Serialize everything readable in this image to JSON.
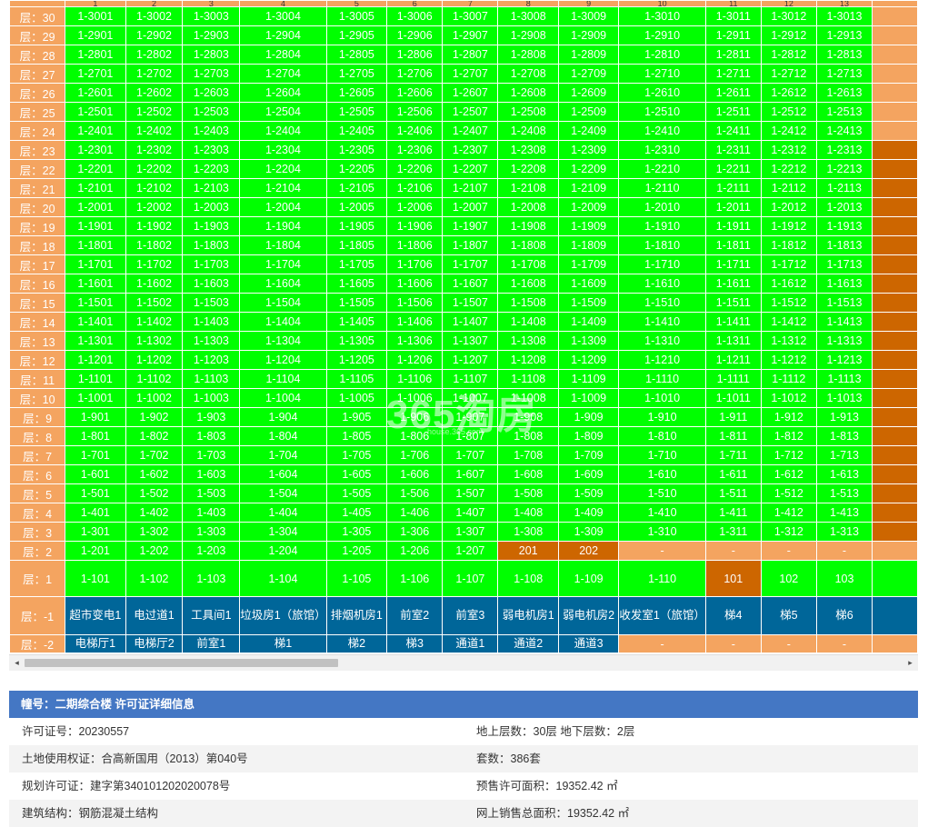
{
  "units": [
    "1",
    "2",
    "3",
    "4",
    "5",
    "6",
    "7",
    "8",
    "9",
    "10",
    "11",
    "12",
    "13"
  ],
  "floors": [
    {
      "label": "层：30",
      "cells": [
        "1-3001",
        "1-3002",
        "1-3003",
        "1-3004",
        "1-3005",
        "1-3006",
        "1-3007",
        "1-3008",
        "1-3009",
        "1-3010",
        "1-3011",
        "1-3012",
        "1-3013"
      ],
      "edge": "sale"
    },
    {
      "label": "层：29",
      "cells": [
        "1-2901",
        "1-2902",
        "1-2903",
        "1-2904",
        "1-2905",
        "1-2906",
        "1-2907",
        "1-2908",
        "1-2909",
        "1-2910",
        "1-2911",
        "1-2912",
        "1-2913"
      ],
      "edge": "sale"
    },
    {
      "label": "层：28",
      "cells": [
        "1-2801",
        "1-2802",
        "1-2803",
        "1-2804",
        "1-2805",
        "1-2806",
        "1-2807",
        "1-2808",
        "1-2809",
        "1-2810",
        "1-2811",
        "1-2812",
        "1-2813"
      ],
      "edge": "sale"
    },
    {
      "label": "层：27",
      "cells": [
        "1-2701",
        "1-2702",
        "1-2703",
        "1-2704",
        "1-2705",
        "1-2706",
        "1-2707",
        "1-2708",
        "1-2709",
        "1-2710",
        "1-2711",
        "1-2712",
        "1-2713"
      ],
      "edge": "sale"
    },
    {
      "label": "层：26",
      "cells": [
        "1-2601",
        "1-2602",
        "1-2603",
        "1-2604",
        "1-2605",
        "1-2606",
        "1-2607",
        "1-2608",
        "1-2609",
        "1-2610",
        "1-2611",
        "1-2612",
        "1-2613"
      ],
      "edge": "sale"
    },
    {
      "label": "层：25",
      "cells": [
        "1-2501",
        "1-2502",
        "1-2503",
        "1-2504",
        "1-2505",
        "1-2506",
        "1-2507",
        "1-2508",
        "1-2509",
        "1-2510",
        "1-2511",
        "1-2512",
        "1-2513"
      ],
      "edge": "sale"
    },
    {
      "label": "层：24",
      "cells": [
        "1-2401",
        "1-2402",
        "1-2403",
        "1-2404",
        "1-2405",
        "1-2406",
        "1-2407",
        "1-2408",
        "1-2409",
        "1-2410",
        "1-2411",
        "1-2412",
        "1-2413"
      ],
      "edge": "sale"
    },
    {
      "label": "层：23",
      "cells": [
        "1-2301",
        "1-2302",
        "1-2303",
        "1-2304",
        "1-2305",
        "1-2306",
        "1-2307",
        "1-2308",
        "1-2309",
        "1-2310",
        "1-2311",
        "1-2312",
        "1-2313"
      ],
      "edge": "sold"
    },
    {
      "label": "层：22",
      "cells": [
        "1-2201",
        "1-2202",
        "1-2203",
        "1-2204",
        "1-2205",
        "1-2206",
        "1-2207",
        "1-2208",
        "1-2209",
        "1-2210",
        "1-2211",
        "1-2212",
        "1-2213"
      ],
      "edge": "sold"
    },
    {
      "label": "层：21",
      "cells": [
        "1-2101",
        "1-2102",
        "1-2103",
        "1-2104",
        "1-2105",
        "1-2106",
        "1-2107",
        "1-2108",
        "1-2109",
        "1-2110",
        "1-2111",
        "1-2112",
        "1-2113"
      ],
      "edge": "sold"
    },
    {
      "label": "层：20",
      "cells": [
        "1-2001",
        "1-2002",
        "1-2003",
        "1-2004",
        "1-2005",
        "1-2006",
        "1-2007",
        "1-2008",
        "1-2009",
        "1-2010",
        "1-2011",
        "1-2012",
        "1-2013"
      ],
      "edge": "sold"
    },
    {
      "label": "层：19",
      "cells": [
        "1-1901",
        "1-1902",
        "1-1903",
        "1-1904",
        "1-1905",
        "1-1906",
        "1-1907",
        "1-1908",
        "1-1909",
        "1-1910",
        "1-1911",
        "1-1912",
        "1-1913"
      ],
      "edge": "sold"
    },
    {
      "label": "层：18",
      "cells": [
        "1-1801",
        "1-1802",
        "1-1803",
        "1-1804",
        "1-1805",
        "1-1806",
        "1-1807",
        "1-1808",
        "1-1809",
        "1-1810",
        "1-1811",
        "1-1812",
        "1-1813"
      ],
      "edge": "sold"
    },
    {
      "label": "层：17",
      "cells": [
        "1-1701",
        "1-1702",
        "1-1703",
        "1-1704",
        "1-1705",
        "1-1706",
        "1-1707",
        "1-1708",
        "1-1709",
        "1-1710",
        "1-1711",
        "1-1712",
        "1-1713"
      ],
      "edge": "sold"
    },
    {
      "label": "层：16",
      "cells": [
        "1-1601",
        "1-1602",
        "1-1603",
        "1-1604",
        "1-1605",
        "1-1606",
        "1-1607",
        "1-1608",
        "1-1609",
        "1-1610",
        "1-1611",
        "1-1612",
        "1-1613"
      ],
      "edge": "sold"
    },
    {
      "label": "层：15",
      "cells": [
        "1-1501",
        "1-1502",
        "1-1503",
        "1-1504",
        "1-1505",
        "1-1506",
        "1-1507",
        "1-1508",
        "1-1509",
        "1-1510",
        "1-1511",
        "1-1512",
        "1-1513"
      ],
      "edge": "sold"
    },
    {
      "label": "层：14",
      "cells": [
        "1-1401",
        "1-1402",
        "1-1403",
        "1-1404",
        "1-1405",
        "1-1406",
        "1-1407",
        "1-1408",
        "1-1409",
        "1-1410",
        "1-1411",
        "1-1412",
        "1-1413"
      ],
      "edge": "sold"
    },
    {
      "label": "层：13",
      "cells": [
        "1-1301",
        "1-1302",
        "1-1303",
        "1-1304",
        "1-1305",
        "1-1306",
        "1-1307",
        "1-1308",
        "1-1309",
        "1-1310",
        "1-1311",
        "1-1312",
        "1-1313"
      ],
      "edge": "sold"
    },
    {
      "label": "层：12",
      "cells": [
        "1-1201",
        "1-1202",
        "1-1203",
        "1-1204",
        "1-1205",
        "1-1206",
        "1-1207",
        "1-1208",
        "1-1209",
        "1-1210",
        "1-1211",
        "1-1212",
        "1-1213"
      ],
      "edge": "sold"
    },
    {
      "label": "层：11",
      "cells": [
        "1-1101",
        "1-1102",
        "1-1103",
        "1-1104",
        "1-1105",
        "1-1106",
        "1-1107",
        "1-1108",
        "1-1109",
        "1-1110",
        "1-1111",
        "1-1112",
        "1-1113"
      ],
      "edge": "sold"
    },
    {
      "label": "层：10",
      "cells": [
        "1-1001",
        "1-1002",
        "1-1003",
        "1-1004",
        "1-1005",
        "1-1006",
        "1-1007",
        "1-1008",
        "1-1009",
        "1-1010",
        "1-1011",
        "1-1012",
        "1-1013"
      ],
      "edge": "sold"
    },
    {
      "label": "层：9",
      "cells": [
        "1-901",
        "1-902",
        "1-903",
        "1-904",
        "1-905",
        "1-906",
        "1-907",
        "1-908",
        "1-909",
        "1-910",
        "1-911",
        "1-912",
        "1-913"
      ],
      "edge": "sold"
    },
    {
      "label": "层：8",
      "cells": [
        "1-801",
        "1-802",
        "1-803",
        "1-804",
        "1-805",
        "1-806",
        "1-807",
        "1-808",
        "1-809",
        "1-810",
        "1-811",
        "1-812",
        "1-813"
      ],
      "edge": "sold"
    },
    {
      "label": "层：7",
      "cells": [
        "1-701",
        "1-702",
        "1-703",
        "1-704",
        "1-705",
        "1-706",
        "1-707",
        "1-708",
        "1-709",
        "1-710",
        "1-711",
        "1-712",
        "1-713"
      ],
      "edge": "sold"
    },
    {
      "label": "层：6",
      "cells": [
        "1-601",
        "1-602",
        "1-603",
        "1-604",
        "1-605",
        "1-606",
        "1-607",
        "1-608",
        "1-609",
        "1-610",
        "1-611",
        "1-612",
        "1-613"
      ],
      "edge": "sold"
    },
    {
      "label": "层：5",
      "cells": [
        "1-501",
        "1-502",
        "1-503",
        "1-504",
        "1-505",
        "1-506",
        "1-507",
        "1-508",
        "1-509",
        "1-510",
        "1-511",
        "1-512",
        "1-513"
      ],
      "edge": "sold"
    },
    {
      "label": "层：4",
      "cells": [
        "1-401",
        "1-402",
        "1-403",
        "1-404",
        "1-405",
        "1-406",
        "1-407",
        "1-408",
        "1-409",
        "1-410",
        "1-411",
        "1-412",
        "1-413"
      ],
      "edge": "sold"
    },
    {
      "label": "层：3",
      "cells": [
        "1-301",
        "1-302",
        "1-303",
        "1-304",
        "1-305",
        "1-306",
        "1-307",
        "1-308",
        "1-309",
        "1-310",
        "1-311",
        "1-312",
        "1-313"
      ],
      "edge": "sold"
    }
  ],
  "floor2": {
    "label": "层：2",
    "cells": [
      {
        "t": "1-201",
        "k": "g"
      },
      {
        "t": "1-202",
        "k": "g"
      },
      {
        "t": "1-203",
        "k": "g"
      },
      {
        "t": "1-204",
        "k": "g"
      },
      {
        "t": "1-205",
        "k": "g"
      },
      {
        "t": "1-206",
        "k": "g"
      },
      {
        "t": "1-207",
        "k": "g"
      },
      {
        "t": "201",
        "k": "o"
      },
      {
        "t": "202",
        "k": "o"
      },
      {
        "t": "-",
        "k": "sa"
      },
      {
        "t": "-",
        "k": "sa"
      },
      {
        "t": "-",
        "k": "sa"
      },
      {
        "t": "-",
        "k": "sa"
      }
    ],
    "edge": "sale"
  },
  "floor1": {
    "label": "层：1",
    "cells": [
      {
        "t": "1-101",
        "k": "g"
      },
      {
        "t": "1-102",
        "k": "g"
      },
      {
        "t": "1-103",
        "k": "g"
      },
      {
        "t": "1-104",
        "k": "g"
      },
      {
        "t": "1-105",
        "k": "g"
      },
      {
        "t": "1-106",
        "k": "g"
      },
      {
        "t": "1-107",
        "k": "g"
      },
      {
        "t": "1-108",
        "k": "g"
      },
      {
        "t": "1-109",
        "k": "g"
      },
      {
        "t": "1-110",
        "k": "g"
      },
      {
        "t": "101",
        "k": "o"
      },
      {
        "t": "102",
        "k": "g"
      },
      {
        "t": "103",
        "k": "g"
      }
    ],
    "edge": "green"
  },
  "floorm1": {
    "label": "层：-1",
    "cells": [
      {
        "t": "超市变电1",
        "k": "b"
      },
      {
        "t": "电过道1",
        "k": "b"
      },
      {
        "t": "工具间1",
        "k": "b"
      },
      {
        "t": "垃圾房1（旅馆）",
        "k": "b"
      },
      {
        "t": "排烟机房1",
        "k": "b"
      },
      {
        "t": "前室2",
        "k": "b"
      },
      {
        "t": "前室3",
        "k": "b"
      },
      {
        "t": "弱电机房1",
        "k": "b"
      },
      {
        "t": "弱电机房2",
        "k": "b"
      },
      {
        "t": "收发室1（旅馆）",
        "k": "b"
      },
      {
        "t": "梯4",
        "k": "b"
      },
      {
        "t": "梯5",
        "k": "b"
      },
      {
        "t": "梯6",
        "k": "b"
      }
    ],
    "edge": "blue"
  },
  "floorm2": {
    "label": "层：-2",
    "cells": [
      {
        "t": "电梯厅1",
        "k": "b"
      },
      {
        "t": "电梯厅2",
        "k": "b"
      },
      {
        "t": "前室1",
        "k": "b"
      },
      {
        "t": "梯1",
        "k": "b"
      },
      {
        "t": "梯2",
        "k": "b"
      },
      {
        "t": "梯3",
        "k": "b"
      },
      {
        "t": "通道1",
        "k": "b"
      },
      {
        "t": "通道2",
        "k": "b"
      },
      {
        "t": "通道3",
        "k": "b"
      },
      {
        "t": "-",
        "k": "sa"
      },
      {
        "t": "-",
        "k": "sa"
      },
      {
        "t": "-",
        "k": "sa"
      },
      {
        "t": "-",
        "k": "sa"
      }
    ],
    "edge": "sale"
  },
  "scrollbar": {
    "left_arrow": "◂",
    "right_arrow": "▸"
  },
  "watermark": {
    "text": "365淘房",
    "sub": "house.365.com"
  },
  "colors": {
    "green": "#00ff00",
    "sold": "#cd6600",
    "sale": "#f4a460",
    "blue": "#006699",
    "header": "#4477c4"
  },
  "info": {
    "header": "幢号：二期综合楼 许可证详细信息",
    "rows": [
      {
        "left": "许可证号：20230557",
        "right": "地上层数：30层  地下层数：2层"
      },
      {
        "left": "土地使用权证：合高新国用（2013）第040号",
        "right": "套数：386套"
      },
      {
        "left": "规划许可证：建字第340101202020078号",
        "right": "预售许可面积：19352.42 ㎡"
      },
      {
        "left": "建筑结构：钢筋混凝土结构",
        "right": "网上销售总面积：19352.42 ㎡"
      }
    ]
  }
}
